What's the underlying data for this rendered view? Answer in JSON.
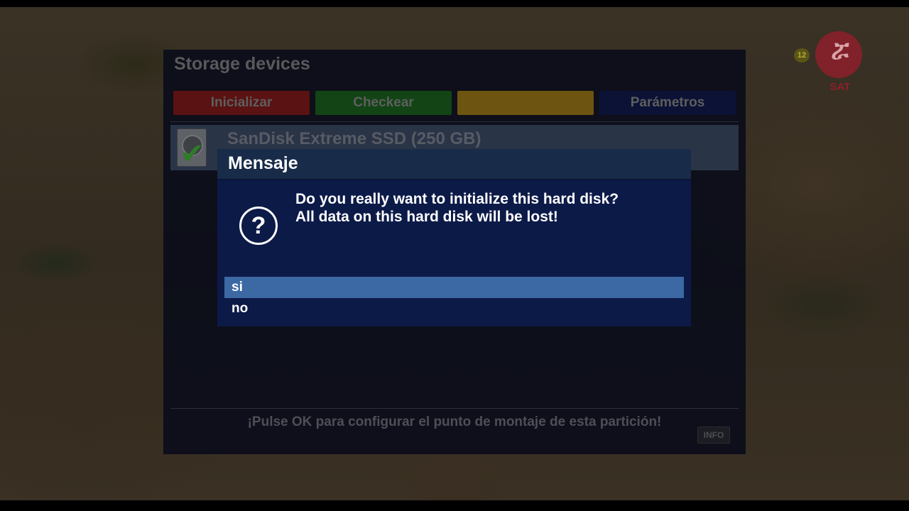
{
  "channel": {
    "logo_text": "SAT",
    "logo_glyph": "ሯ",
    "age_rating": "12",
    "logo_color": "#8e1f2c"
  },
  "storage_panel": {
    "title": "Storage devices",
    "buttons": {
      "red": "Inicializar",
      "green": "Checkear",
      "yellow": "",
      "blue": "Parámetros"
    },
    "device": {
      "name": "SanDisk Extreme SSD (250 GB)",
      "icon": "hdd-icon",
      "status_icon": "checkmark-icon"
    },
    "hint": "¡Pulse OK para configurar el punto de montaje de esta partición!",
    "info_key": "INFO"
  },
  "dialog": {
    "title": "Mensaje",
    "icon": "question-icon",
    "message_lines": [
      "Do you really want to initialize this hard disk?",
      "All data on this hard disk will be lost!"
    ],
    "options": [
      "si",
      "no"
    ],
    "selected_option": "si",
    "selection_color": "#3c68a4"
  }
}
